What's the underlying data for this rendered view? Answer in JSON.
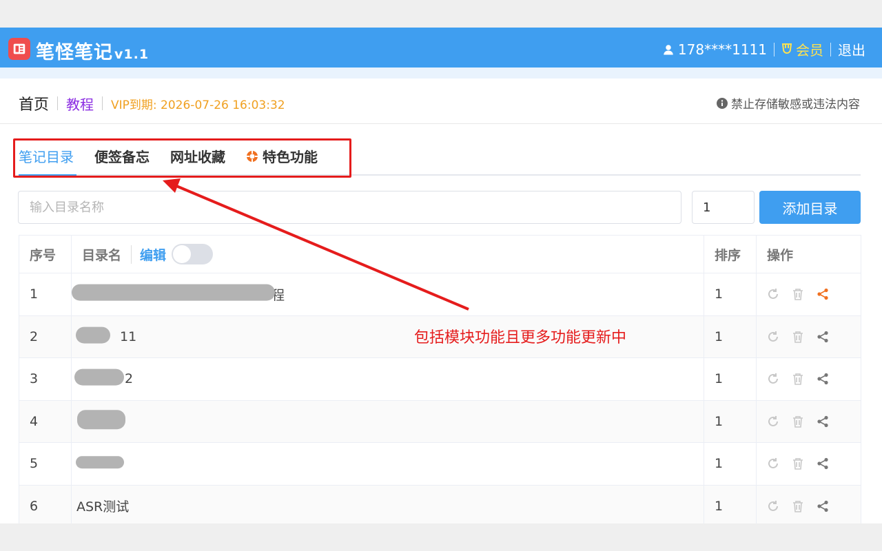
{
  "header": {
    "app_name": "笔怪笔记",
    "version": "v1.1",
    "username": "178****1111",
    "vip_label": "会员",
    "logout_label": "退出"
  },
  "breadcrumb": {
    "home": "首页",
    "tutorial": "教程",
    "vip_expire": "VIP到期: 2026-07-26 16:03:32"
  },
  "notice": "禁止存储敏感或违法内容",
  "tabs": [
    {
      "label": "笔记目录"
    },
    {
      "label": "便签备忘"
    },
    {
      "label": "网址收藏"
    },
    {
      "label": "特色功能"
    }
  ],
  "form": {
    "name_placeholder": "输入目录名称",
    "order_value": "1",
    "add_button": "添加目录"
  },
  "table": {
    "headers": {
      "index": "序号",
      "name": "目录名",
      "edit": "编辑",
      "order": "排序",
      "actions": "操作"
    },
    "rows": [
      {
        "index": "1",
        "name": "程",
        "order": "1"
      },
      {
        "index": "2",
        "name": "11",
        "order": "1"
      },
      {
        "index": "3",
        "name": "2",
        "order": "1"
      },
      {
        "index": "4",
        "name": "",
        "order": "1"
      },
      {
        "index": "5",
        "name": "",
        "order": "1"
      },
      {
        "index": "6",
        "name": "ASR测试",
        "order": "1"
      }
    ]
  },
  "annotation": "包括模块功能且更多功能更新中",
  "colors": {
    "primary": "#3f9ef0",
    "annotation": "#e51c1c",
    "vip": "#f0a020",
    "share_active": "#f07020"
  }
}
